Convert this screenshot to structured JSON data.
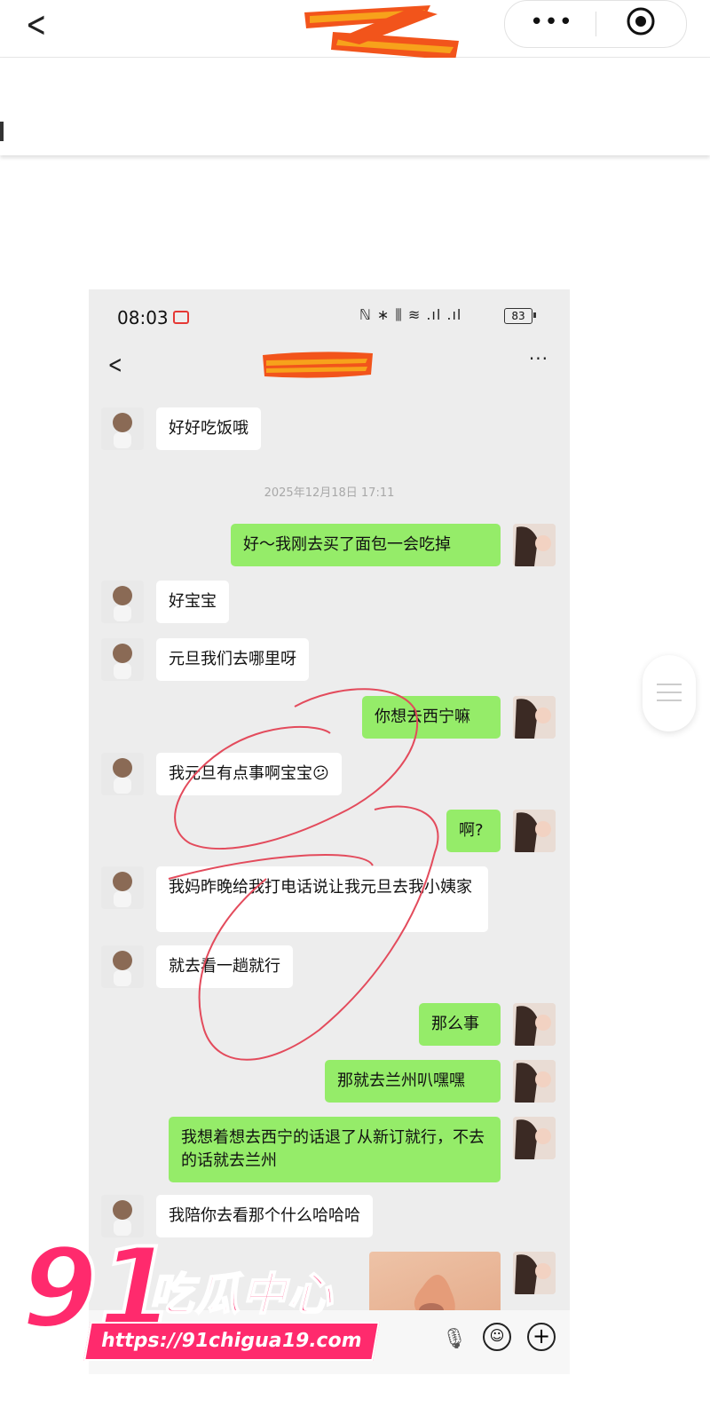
{
  "colors": {
    "outgoing_bubble": "#95ec69",
    "incoming_bubble": "#ffffff",
    "chat_background": "#ededed",
    "watermark": "#ff2a6d",
    "redaction": [
      "#f2541b",
      "#f7a21b"
    ]
  },
  "icons": {
    "header_back": "chevron-left",
    "header_more": "more-dots",
    "header_target": "target-circle",
    "status_rec": "screen-record",
    "nav_back": "chevron-left",
    "nav_more": "more-dots",
    "input_voice": "microphone",
    "input_emoji": "smiley",
    "input_plus": "plus-circle"
  },
  "header": {
    "back": "<",
    "more": "•••"
  },
  "phone": {
    "status": {
      "time": "08:03",
      "icons": "ℕ ∗ ⫼ ≋ .ıl .ıl",
      "battery": "83"
    },
    "nav": {
      "back": "<",
      "more": "···"
    },
    "timestamp": "2025年12月18日 17:11",
    "messages": [
      {
        "side": "in",
        "text": "好好吃饭哦"
      },
      {
        "side": "out",
        "text": "好～我刚去买了面包一会吃掉"
      },
      {
        "side": "in",
        "text": "好宝宝"
      },
      {
        "side": "in",
        "text": "元旦我们去哪里呀"
      },
      {
        "side": "out",
        "text": "你想去西宁嘛"
      },
      {
        "side": "in",
        "text": "我元旦有点事啊宝宝😕"
      },
      {
        "side": "out",
        "text": "啊?"
      },
      {
        "side": "in",
        "text": "我妈昨晚给我打电话说让我元旦去我小姨家"
      },
      {
        "side": "in",
        "text": "就去看一趟就行"
      },
      {
        "side": "out",
        "text": "那么事"
      },
      {
        "side": "out",
        "text": "那就去兰州叭嘿嘿"
      },
      {
        "side": "out",
        "text": "我想着想去西宁的话退了从新订就行，不去的话就去兰州"
      },
      {
        "side": "in",
        "text": "我陪你去看那个什么哈哈哈"
      }
    ],
    "input": {
      "mic": "🎙",
      "emoji": "☺",
      "plus": "+"
    }
  },
  "watermark": {
    "number": "91",
    "name": "吃瓜中心",
    "url": "https://91chigua19.com"
  }
}
